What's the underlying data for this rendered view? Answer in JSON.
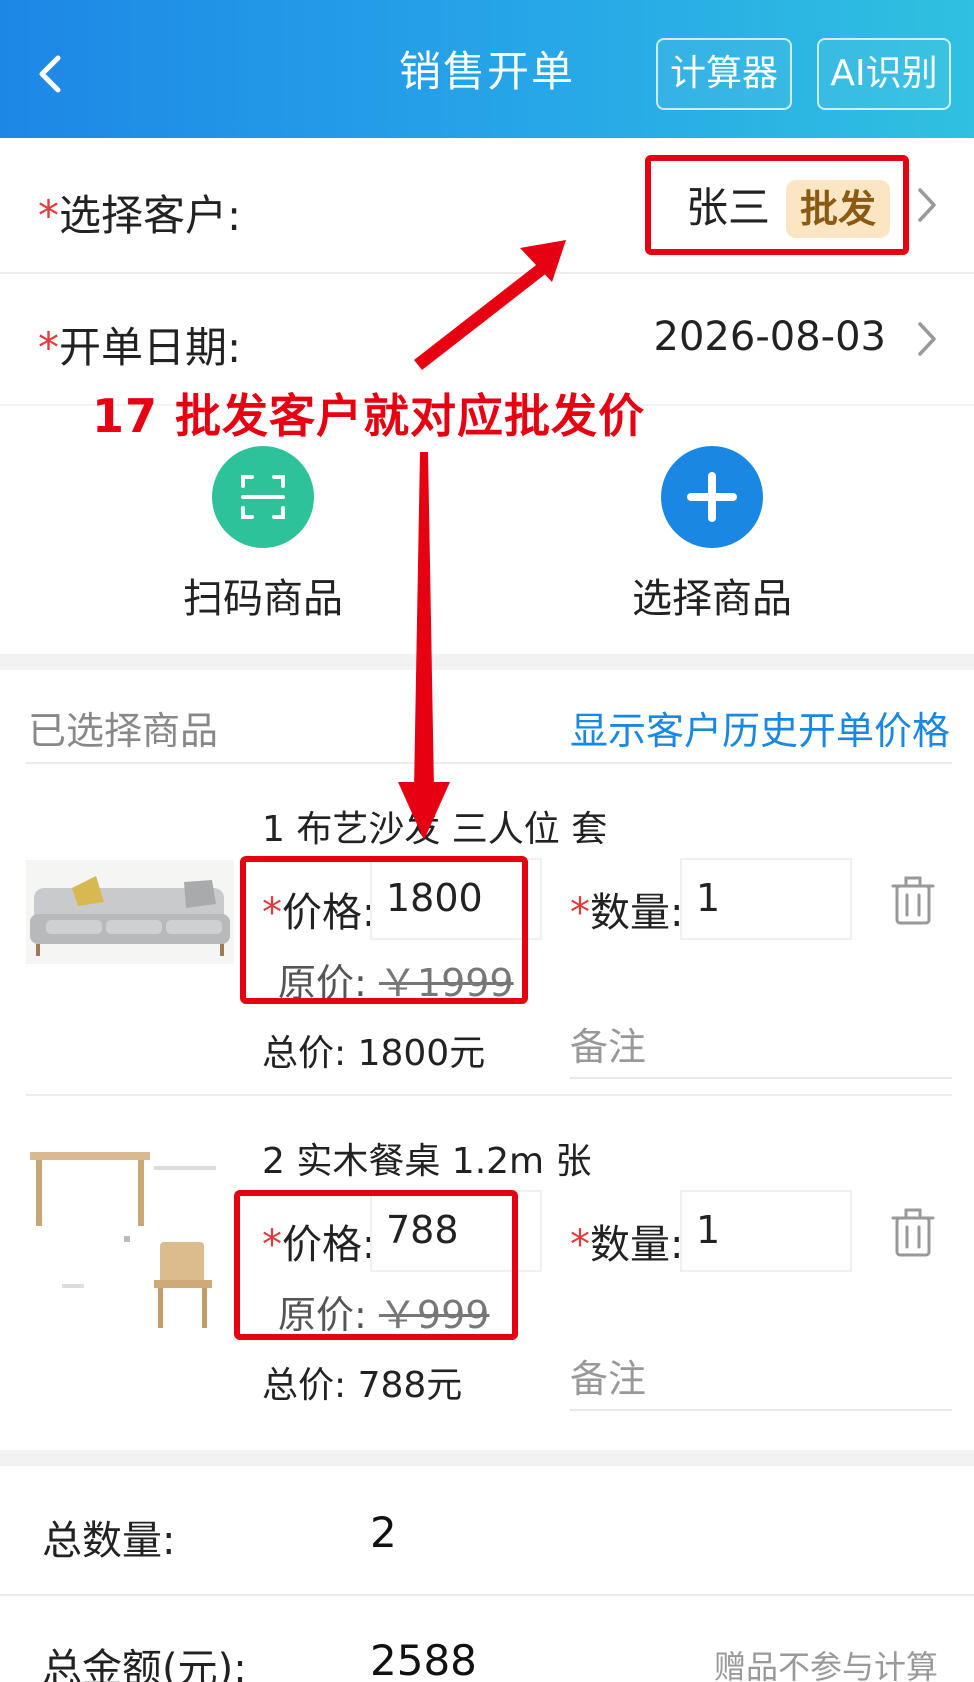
{
  "header": {
    "title": "销售开单",
    "calculator_label": "计算器",
    "ai_label": "AI识别"
  },
  "customer": {
    "label": "选择客户:",
    "required_mark": "*",
    "name": "张三",
    "tag": "批发"
  },
  "date": {
    "label": "开单日期:",
    "required_mark": "*",
    "value": "2026-08-03"
  },
  "annotation": {
    "text": "17 批发客户就对应批发价"
  },
  "actions": {
    "scan_label": "扫码商品",
    "select_label": "选择商品"
  },
  "selected": {
    "title": "已选择商品",
    "history_link": "显示客户历史开单价格",
    "items": [
      {
        "name": "1 布艺沙发 三人位 套",
        "price_label": "价格:",
        "price": "1800",
        "orig_label": "原价:",
        "orig_price": "￥1999",
        "qty_label": "数量:",
        "qty": "1",
        "total": "总价: 1800元",
        "note_placeholder": "备注"
      },
      {
        "name": "2 实木餐桌 1.2m 张",
        "price_label": "价格:",
        "price": "788",
        "orig_label": "原价:",
        "orig_price": "￥999",
        "qty_label": "数量:",
        "qty": "1",
        "total": "总价: 788元",
        "note_placeholder": "备注"
      }
    ]
  },
  "summary": {
    "qty_label": "总数量:",
    "qty_value": "2",
    "amount_label": "总金额(元):",
    "amount_value": "2588",
    "gift_note": "赠品不参与计算"
  },
  "colors": {
    "header_start": "#1d87e6",
    "header_end": "#2fc1df",
    "annotation_red": "#e60012",
    "link_blue": "#1a87e3",
    "scan_green": "#2ec29a",
    "badge_bg": "#fbe6c3"
  }
}
